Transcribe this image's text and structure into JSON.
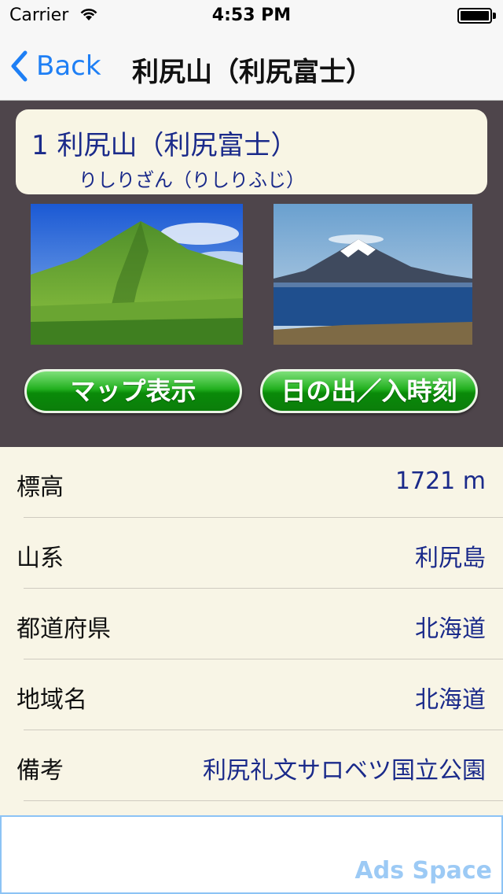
{
  "status_bar": {
    "carrier": "Carrier",
    "time": "4:53 PM",
    "icons": [
      "wifi-icon",
      "battery-icon"
    ]
  },
  "nav": {
    "back_label": "Back",
    "title": "利尻山（利尻富士）"
  },
  "mountain": {
    "name_line": "1 利尻山（利尻富士）",
    "reading": "りしりざん（りしりふじ）"
  },
  "buttons": {
    "map": "マップ表示",
    "sun": "日の出／入時刻"
  },
  "details": [
    {
      "label": "標高",
      "value": "1721 m"
    },
    {
      "label": "山系",
      "value": "利尻島"
    },
    {
      "label": "都道府県",
      "value": "北海道"
    },
    {
      "label": "地域名",
      "value": "北海道"
    },
    {
      "label": "備考",
      "value": "利尻礼文サロベツ国立公園"
    }
  ],
  "ads": {
    "label": "Ads Space"
  },
  "colors": {
    "nav_tint": "#1e7ff5",
    "header_bg": "#4e454b",
    "card_bg": "#f8f5e4",
    "value_text": "#1a2a8a",
    "button_green": "#22b01f"
  }
}
